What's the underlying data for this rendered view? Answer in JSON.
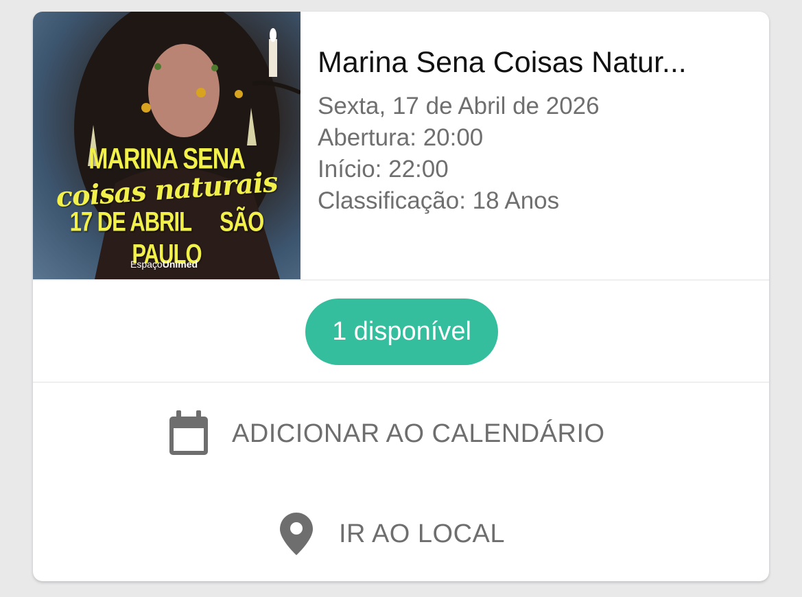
{
  "event": {
    "title": "Marina Sena Coisas Natur...",
    "date": "Sexta, 17 de Abril de 2026",
    "opening": "Abertura: 20:00",
    "start": "Início: 22:00",
    "rating": "Classificação: 18 Anos"
  },
  "poster": {
    "artist": "MARINA   SENA",
    "tour": "coisas naturais",
    "event_date": "17 DE ABRIL",
    "city": "SÃO PAULO",
    "venue_prefix": "Espaço",
    "venue_name": "Unimed",
    "text_color": "#f2f04a"
  },
  "availability": {
    "label": "1 disponível",
    "color": "#35be9e"
  },
  "actions": {
    "calendar": {
      "label": "ADICIONAR AO CALENDÁRIO",
      "icon": "calendar-icon"
    },
    "location": {
      "label": "IR AO LOCAL",
      "icon": "map-pin-icon"
    }
  }
}
